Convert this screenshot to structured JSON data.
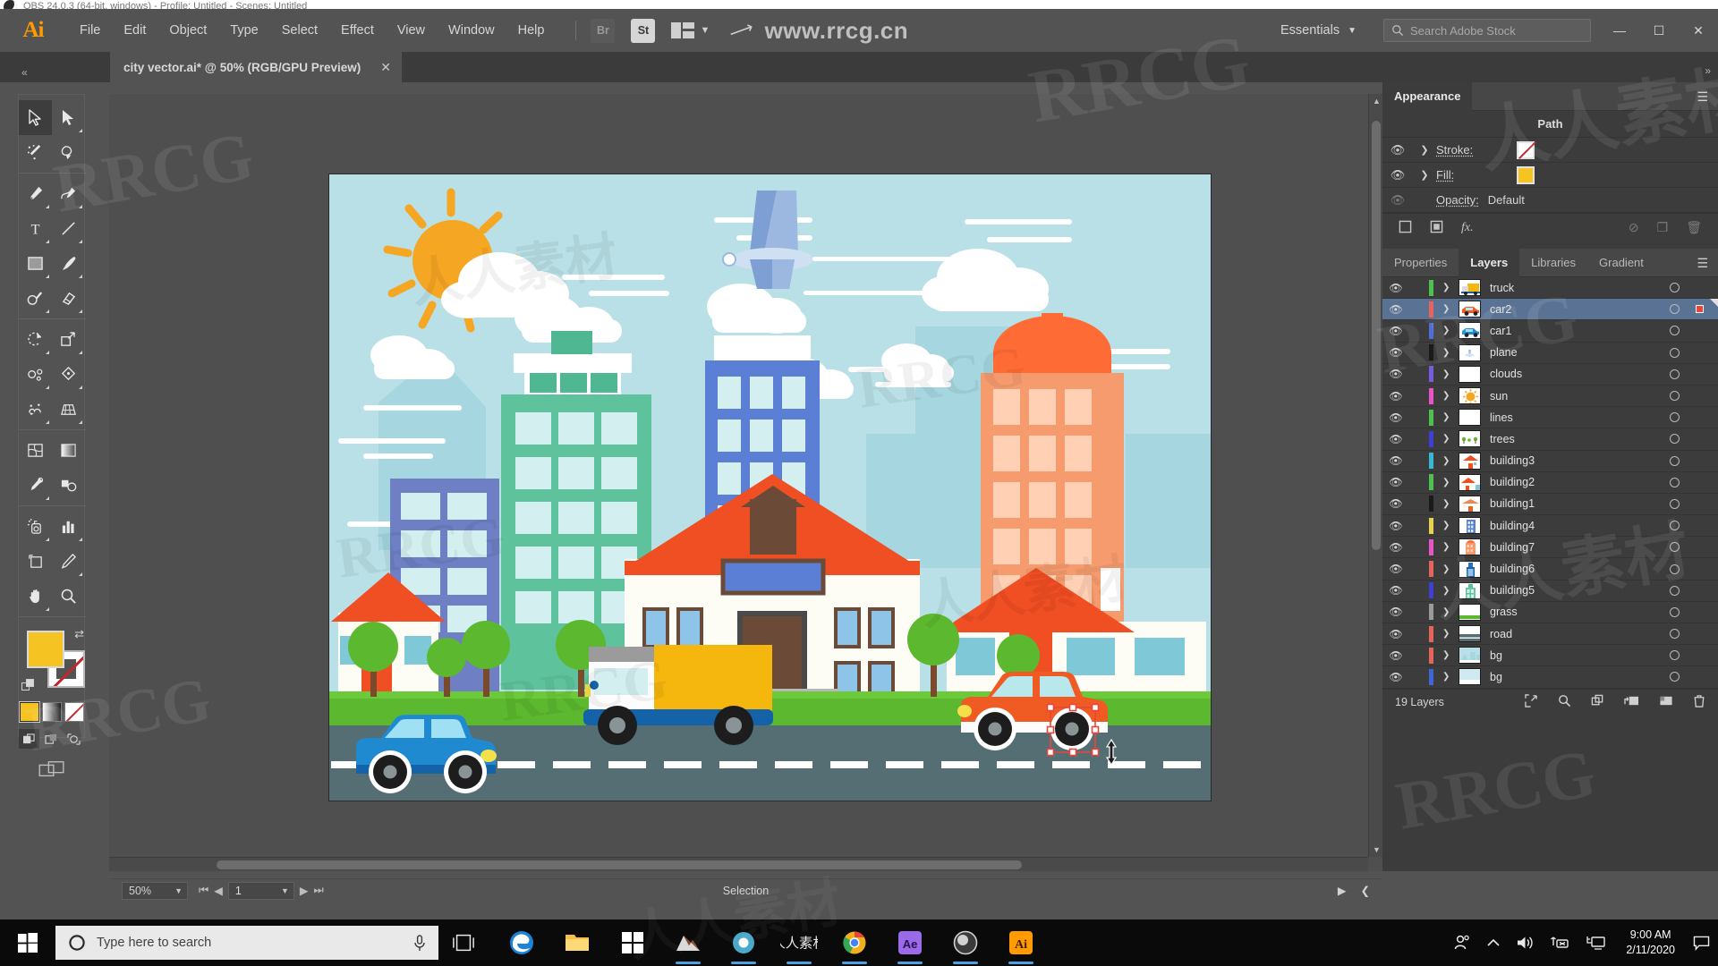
{
  "obs": {
    "title": "OBS 24.0.3 (64-bit, windows) - Profile: Untitled - Scenes: Untitled"
  },
  "menubar": {
    "logo": "Ai",
    "items": [
      "File",
      "Edit",
      "Object",
      "Type",
      "Select",
      "Effect",
      "View",
      "Window",
      "Help"
    ],
    "chips": [
      {
        "name": "bridge-chip",
        "label": "Br"
      },
      {
        "name": "stock-chip",
        "label": "St"
      }
    ],
    "watermark_url": "www.rrcg.cn",
    "workspace": "Essentials",
    "search_placeholder": "Search Adobe Stock",
    "window_controls": {
      "minimize": "—",
      "maximize": "☐",
      "close": "✕"
    }
  },
  "tab": {
    "title": "city vector.ai* @ 50% (RGB/GPU Preview)",
    "close": "✕"
  },
  "toolbar": {
    "tools": [
      "selection-tool",
      "direct-selection-tool",
      "magic-wand-tool",
      "lasso-tool",
      "pen-tool",
      "curvature-tool",
      "type-tool",
      "line-segment-tool",
      "rectangle-tool",
      "paintbrush-tool",
      "shaper-tool",
      "eraser-tool",
      "rotate-tool",
      "scale-tool",
      "width-tool",
      "free-transform-tool",
      "shape-builder-tool",
      "perspective-grid-tool",
      "mesh-tool",
      "gradient-tool",
      "eyedropper-tool",
      "blend-tool",
      "symbol-sprayer-tool",
      "column-graph-tool",
      "artboard-tool",
      "slice-tool",
      "hand-tool",
      "zoom-tool"
    ],
    "active_tool": "selection-tool",
    "fill_color": "#f5c423",
    "stroke_color": "#ffffff",
    "color_modes": [
      "color-mode",
      "gradient-mode",
      "none-mode"
    ],
    "draw_modes": [
      "draw-normal",
      "draw-behind",
      "draw-inside"
    ],
    "screen_mode": "change-screen-mode"
  },
  "appearance": {
    "panel_title": "Appearance",
    "object_type": "Path",
    "rows": [
      {
        "label": "Stroke:",
        "swatch": "none",
        "name": "stroke-row"
      },
      {
        "label": "Fill:",
        "swatch": "yellow",
        "name": "fill-row"
      }
    ],
    "opacity_label": "Opacity:",
    "opacity_value": "Default",
    "footer_icons": [
      "add-new-stroke",
      "add-new-fill",
      "add-new-effect",
      "clear-appearance",
      "duplicate-item",
      "delete-item"
    ]
  },
  "panels": {
    "tabs": [
      "Properties",
      "Layers",
      "Libraries",
      "Gradient"
    ],
    "active_tab": "Layers"
  },
  "layers": {
    "count_label": "19 Layers",
    "selected": "car2",
    "items": [
      {
        "name": "truck",
        "color": "#4cc14c",
        "thumb": "truck"
      },
      {
        "name": "car2",
        "color": "#e8635a",
        "thumb": "car-orange"
      },
      {
        "name": "car1",
        "color": "#4b6fd6",
        "thumb": "car-blue"
      },
      {
        "name": "plane",
        "color": "#1a1a1a",
        "thumb": "plane"
      },
      {
        "name": "clouds",
        "color": "#7a5ae0",
        "thumb": "blank"
      },
      {
        "name": "sun",
        "color": "#e855c7",
        "thumb": "sun"
      },
      {
        "name": "lines",
        "color": "#4cc14c",
        "thumb": "blank"
      },
      {
        "name": "trees",
        "color": "#3f3fd6",
        "thumb": "trees"
      },
      {
        "name": "building3",
        "color": "#36b8d6",
        "thumb": "house-orange"
      },
      {
        "name": "building2",
        "color": "#4cc14c",
        "thumb": "house-red"
      },
      {
        "name": "building1",
        "color": "#1a1a1a",
        "thumb": "house-cream"
      },
      {
        "name": "building4",
        "color": "#e8d44c",
        "thumb": "tower-blue"
      },
      {
        "name": "building7",
        "color": "#e855c7",
        "thumb": "tower-orange"
      },
      {
        "name": "building6",
        "color": "#e8635a",
        "thumb": "tower-navy"
      },
      {
        "name": "building5",
        "color": "#3f3fd6",
        "thumb": "tower-teal"
      },
      {
        "name": "grass",
        "color": "#9a9a9a",
        "thumb": "grass"
      },
      {
        "name": "road",
        "color": "#e8635a",
        "thumb": "road"
      },
      {
        "name": "bg",
        "color": "#e8635a",
        "thumb": "bg-city"
      },
      {
        "name": "bg",
        "color": "#3f66d6",
        "thumb": "bg-sky"
      }
    ]
  },
  "statusbar": {
    "zoom": "50%",
    "artboard": "1",
    "tool": "Selection"
  },
  "artwork": {
    "title": "city vector illustration",
    "sky_color": "#b8e0e6",
    "grass_color": "#5cb82e",
    "road_color": "#546e74",
    "sun_color": "#f5a623",
    "buildings": [
      "green-office",
      "blue-office",
      "orange-tower",
      "white-school",
      "red-roof-house",
      "right-house"
    ],
    "vehicles": [
      "blue-car",
      "yellow-truck",
      "orange-car"
    ]
  },
  "taskbar": {
    "search_placeholder": "Type here to search",
    "apps": [
      "edge",
      "file-explorer",
      "store",
      "app-teal",
      "chrome-like",
      "rrcg",
      "chrome",
      "after-effects",
      "obs",
      "illustrator"
    ],
    "clock_time": "9:00 AM",
    "clock_date": "2/11/2020",
    "tray": [
      "people",
      "show-hidden",
      "volume",
      "network",
      "display"
    ]
  }
}
